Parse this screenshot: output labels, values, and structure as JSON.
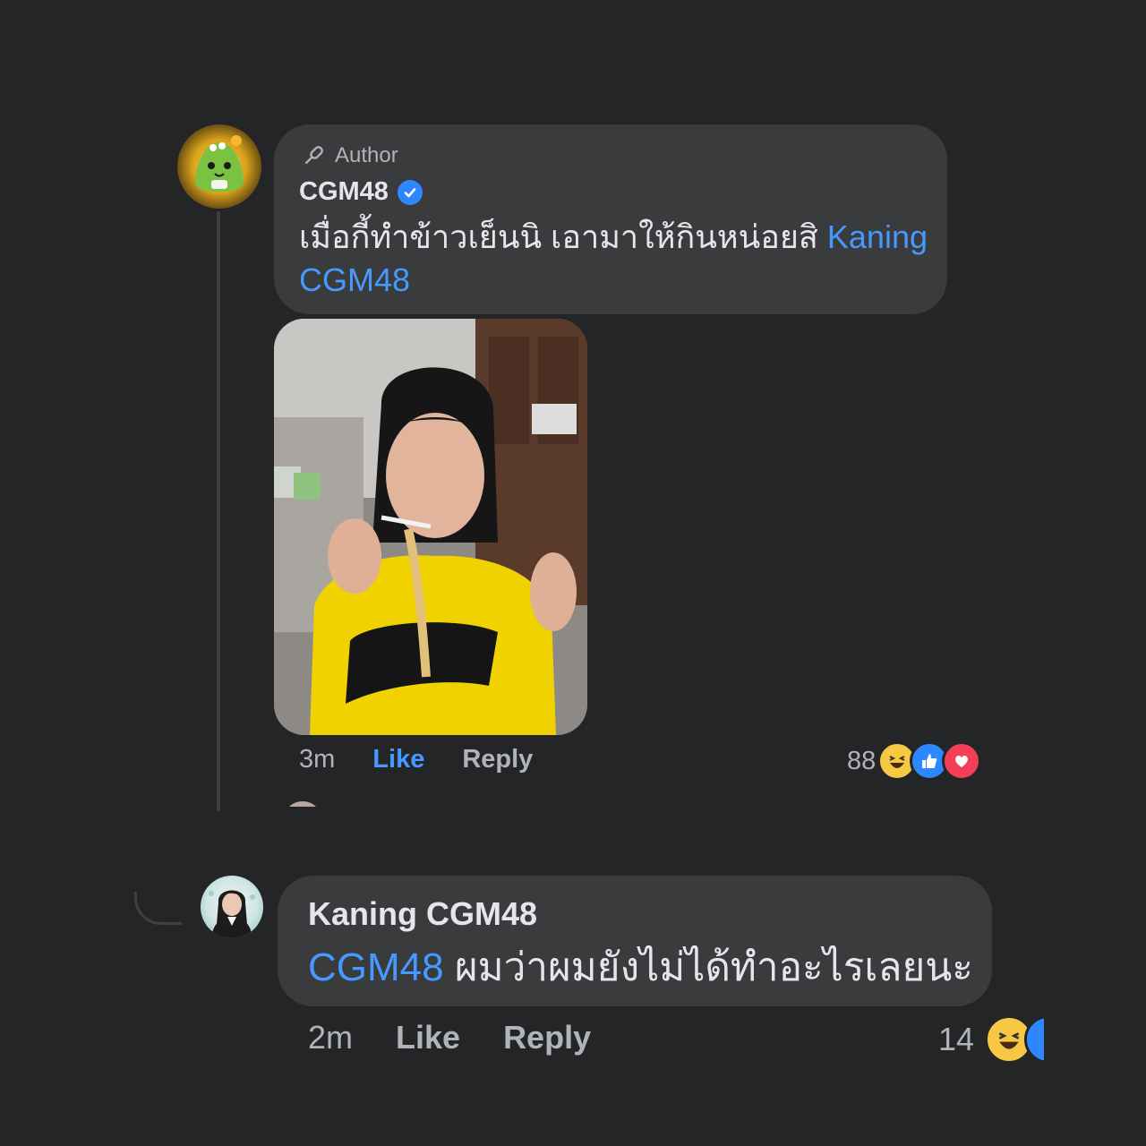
{
  "comment": {
    "badge_label": "Author",
    "author_name": "CGM48",
    "text": "เมื่อกี้ทำข้าวเย็นนิ เอามาให้กินหน่อยสิ ",
    "mention": "Kaning CGM48",
    "time": "3m",
    "like_label": "Like",
    "reply_label": "Reply",
    "reaction_count": "88",
    "reaction_icons": [
      "haha-icon",
      "like-icon",
      "love-icon"
    ],
    "like_active": true
  },
  "reply": {
    "author_name": "Kaning CGM48",
    "mention": "CGM48",
    "text": " ผมว่าผมยังไม่ได้ทำอะไรเลยนะ",
    "time": "2m",
    "like_label": "Like",
    "reply_label": "Reply",
    "reaction_count": "14",
    "reaction_icons": [
      "haha-icon",
      "like-icon"
    ]
  },
  "colors": {
    "background": "#242526",
    "bubble": "#3a3b3c",
    "mention": "#4599ff",
    "verified": "#2d88ff",
    "muted_text": "#b0b3b8"
  }
}
